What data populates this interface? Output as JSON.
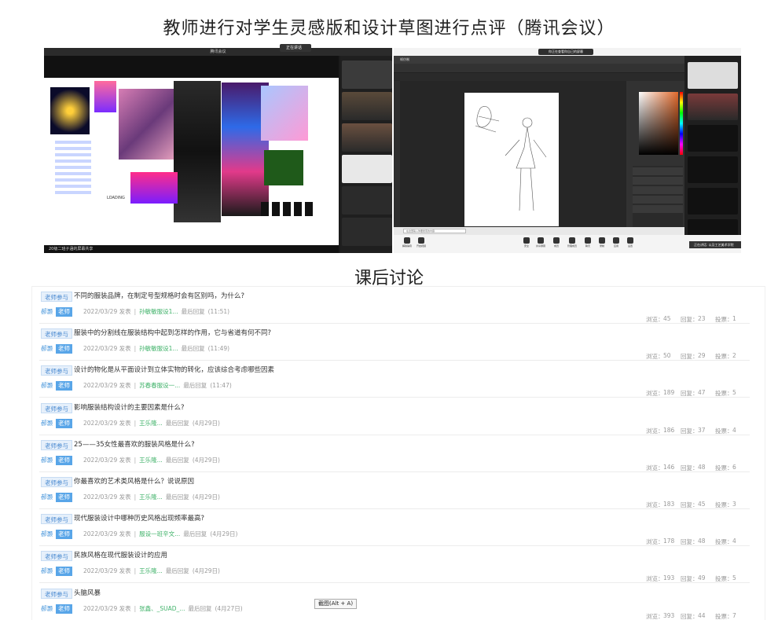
{
  "heading_top": "教师进行对学生灵感版和设计草图进行点评（腾讯会议）",
  "heading_mid": "课后讨论",
  "left_window": {
    "title": "腾讯会议",
    "tooltip": "正在讲话",
    "bottom_status": "20级二班子涵的屏幕共享",
    "loading_label": "LOADING"
  },
  "right_window": {
    "meeting_pill": "你正在查看你自己的屏幕",
    "tab_label": "帧仿制",
    "search_placeholder": "在这里输入你要搜索的内容",
    "chip": "正在讲话: 以及工艺美术学院",
    "meeting_bar": [
      "解除静音",
      "开启视频",
      "安全",
      "共享屏幕",
      "成员",
      "管理成员",
      "聊天",
      "录制",
      "应用",
      "设置"
    ]
  },
  "tags": {
    "participate": "老师参与",
    "name": "郝灏",
    "teacher": "老师"
  },
  "labels": {
    "posted": "发表",
    "last_reply": "最后回复",
    "views": "浏览：",
    "replies": "回复：",
    "votes": "投票："
  },
  "threads": [
    {
      "title": "不同的服装品牌，在制定号型规格时会有区别吗，为什么?",
      "date": "2022/03/29",
      "author": "孙敏敏服设1...",
      "last": "(11:51)",
      "views": "45",
      "replies": "23",
      "votes": "1"
    },
    {
      "title": "服装中的分割线在服装结构中起到怎样的作用，它与省道有何不同?",
      "date": "2022/03/29",
      "author": "孙敏敏服设1...",
      "last": "(11:49)",
      "views": "50",
      "replies": "29",
      "votes": "2"
    },
    {
      "title": "设计的物化是从平面设计到立体实物的转化，应该综合考虑哪些因素",
      "date": "2022/03/29",
      "author": "苏春春服设一...",
      "last": "(11:47)",
      "views": "189",
      "replies": "47",
      "votes": "5"
    },
    {
      "title": "影响服装结构设计的主要因素是什么?",
      "date": "2022/03/29",
      "author": "王乐隆...",
      "last": "(4月29日)",
      "views": "186",
      "replies": "37",
      "votes": "4"
    },
    {
      "title": "25——35女性最喜欢的服装风格是什么?",
      "date": "2022/03/29",
      "author": "王乐隆...",
      "last": "(4月29日)",
      "views": "146",
      "replies": "48",
      "votes": "6"
    },
    {
      "title": "你最喜欢的艺术类风格是什么？说说原因",
      "date": "2022/03/29",
      "author": "王乐隆...",
      "last": "(4月29日)",
      "views": "183",
      "replies": "45",
      "votes": "3"
    },
    {
      "title": "现代服装设计中哪种历史风格出现频率最高?",
      "date": "2022/03/29",
      "author": "服设一班辛文...",
      "last": "(4月29日)",
      "views": "178",
      "replies": "48",
      "votes": "4"
    },
    {
      "title": "民族风格在现代服装设计的应用",
      "date": "2022/03/29",
      "author": "王乐隆...",
      "last": "(4月29日)",
      "views": "193",
      "replies": "49",
      "votes": "5"
    },
    {
      "title": "头脑风暴",
      "date": "2022/03/29",
      "author": "张鑫、_SUAD_...",
      "last": "(4月27日)",
      "views": "393",
      "replies": "44",
      "votes": "7"
    }
  ],
  "screenshot_tooltip": "截图(Alt + A)"
}
